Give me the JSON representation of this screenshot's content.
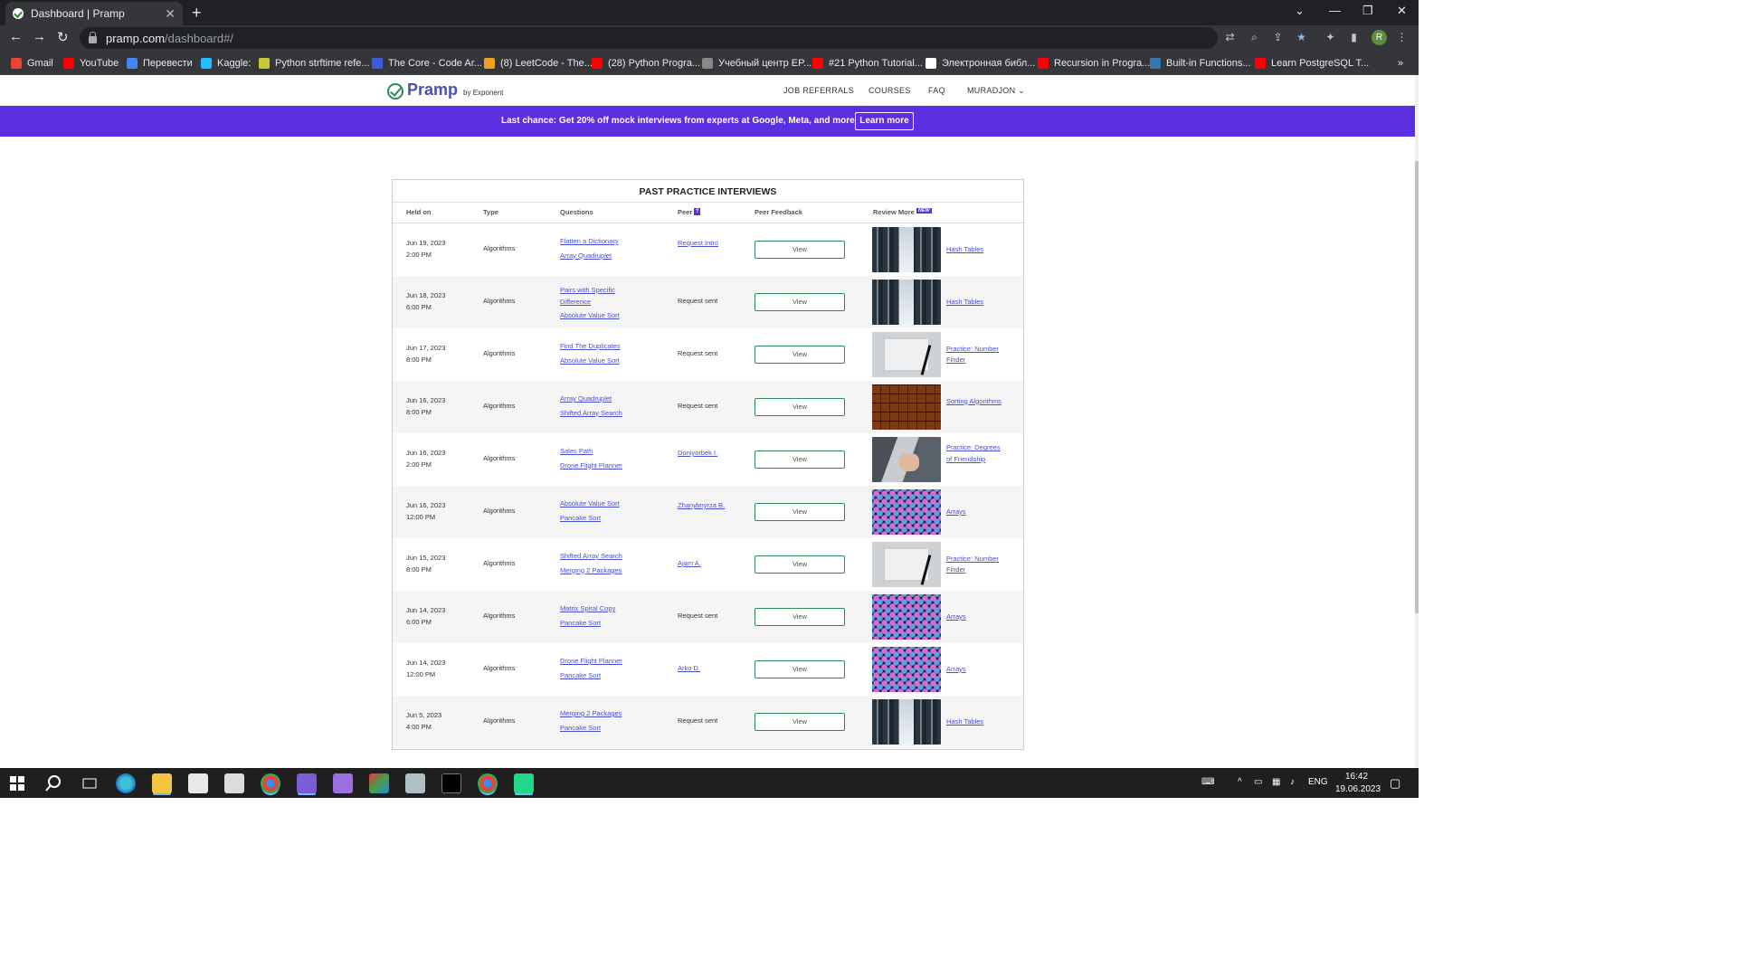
{
  "browser": {
    "tab_title": "Dashboard | Pramp",
    "url_host": "pramp.com",
    "url_path": "/dashboard#/",
    "profile_initial": "R",
    "bookmarks": [
      {
        "label": "Gmail",
        "color": "#ea4335"
      },
      {
        "label": "YouTube",
        "color": "#ff0000"
      },
      {
        "label": "Перевести",
        "color": "#4285f4"
      },
      {
        "label": "Kaggle:",
        "color": "#20beff"
      },
      {
        "label": "Python strftime refe...",
        "color": "#c9c935"
      },
      {
        "label": "The Core - Code Ar...",
        "color": "#3b5bdb"
      },
      {
        "label": "(8) LeetCode - The...",
        "color": "#f0a020"
      },
      {
        "label": "(28) Python Progra...",
        "color": "#ff0000"
      },
      {
        "label": "Учебный центр EP...",
        "color": "#888888"
      },
      {
        "label": "#21 Python Tutorial...",
        "color": "#ff0000"
      },
      {
        "label": "Электронная библ...",
        "color": "#ffffff"
      },
      {
        "label": "Recursion in Progra...",
        "color": "#ff0000"
      },
      {
        "label": "Built-in Functions...",
        "color": "#3776ab"
      },
      {
        "label": "Learn PostgreSQL T...",
        "color": "#ff0000"
      }
    ]
  },
  "site": {
    "logo_text": "Pramp",
    "logo_by": "by Exponent",
    "nav": {
      "referrals": "JOB REFERRALS",
      "courses": "COURSES",
      "faq": "FAQ",
      "user": "MURADJON"
    },
    "promo": {
      "message": "Last chance: Get 20% off mock interviews from experts at Google, Meta, and more",
      "button": "Learn more"
    },
    "accent": "#5b2fe0",
    "view_border": "#2e8b57"
  },
  "table": {
    "title": "PAST PRACTICE INTERVIEWS",
    "headers": {
      "held_on": "Held on",
      "type": "Type",
      "questions": "Questions",
      "peer": "Peer",
      "peer_help": "?",
      "feedback": "Peer Feedback",
      "review": "Review More",
      "review_badge": "NEW"
    },
    "view_label": "View",
    "rows": [
      {
        "date": "Jun 19, 2023",
        "time": "2:00 PM",
        "type": "Algorithms",
        "q1": "Flatten a Dictionary",
        "q2": "Array Quadruplet",
        "peer": "Request Intro",
        "peer_link": true,
        "thumb": "hash",
        "review": "Hash Tables"
      },
      {
        "date": "Jun 18, 2023",
        "time": "6:00 PM",
        "type": "Algorithms",
        "q1": "Pairs with Specific Difference",
        "q2": "Absolute Value Sort",
        "peer": "Request sent",
        "peer_link": false,
        "thumb": "hash",
        "review": "Hash Tables"
      },
      {
        "date": "Jun 17, 2023",
        "time": "8:00 PM",
        "type": "Algorithms",
        "q1": "Find The Duplicates",
        "q2": "Absolute Value Sort",
        "peer": "Request sent",
        "peer_link": false,
        "thumb": "num",
        "review": "Practice: Number Finder"
      },
      {
        "date": "Jun 16, 2023",
        "time": "8:00 PM",
        "type": "Algorithms",
        "q1": "Array Quadruplet",
        "q2": "Shifted Array Search",
        "peer": "Request sent",
        "peer_link": false,
        "thumb": "sort",
        "review": "Sorting Algorithms"
      },
      {
        "date": "Jun 16, 2023",
        "time": "2:00 PM",
        "type": "Algorithms",
        "q1": "Sales Path",
        "q2": "Drone Flight Planner",
        "peer": "Doniyorbek I.",
        "peer_link": true,
        "thumb": "deg",
        "review": "Practice: Degrees of Friendship"
      },
      {
        "date": "Jun 16, 2023",
        "time": "12:00 PM",
        "type": "Algorithms",
        "q1": "Absolute Value Sort",
        "q2": "Pancake Sort",
        "peer": "Zhanylmyrza B.",
        "peer_link": true,
        "thumb": "arr",
        "review": "Arrays"
      },
      {
        "date": "Jun 15, 2023",
        "time": "8:00 PM",
        "type": "Algorithms",
        "q1": "Shifted Array Search",
        "q2": "Merging 2 Packages",
        "peer": "Ajam A.",
        "peer_link": true,
        "thumb": "num",
        "review": "Practice: Number Finder"
      },
      {
        "date": "Jun 14, 2023",
        "time": "6:00 PM",
        "type": "Algorithms",
        "q1": "Matrix Spiral Copy",
        "q2": "Pancake Sort",
        "peer": "Request sent",
        "peer_link": false,
        "thumb": "arr",
        "review": "Arrays"
      },
      {
        "date": "Jun 14, 2023",
        "time": "12:00 PM",
        "type": "Algorithms",
        "q1": "Drone Flight Planner",
        "q2": "Pancake Sort",
        "peer": "Arko D.",
        "peer_link": true,
        "thumb": "arr",
        "review": "Arrays"
      },
      {
        "date": "Jun 5, 2023",
        "time": "4:00 PM",
        "type": "Algorithms",
        "q1": "Merging 2 Packages",
        "q2": "Pancake Sort",
        "peer": "Request sent",
        "peer_link": false,
        "thumb": "hash",
        "review": "Hash Tables"
      }
    ]
  },
  "taskbar": {
    "lang": "ENG",
    "time": "16:42",
    "date": "19.06.2023"
  }
}
